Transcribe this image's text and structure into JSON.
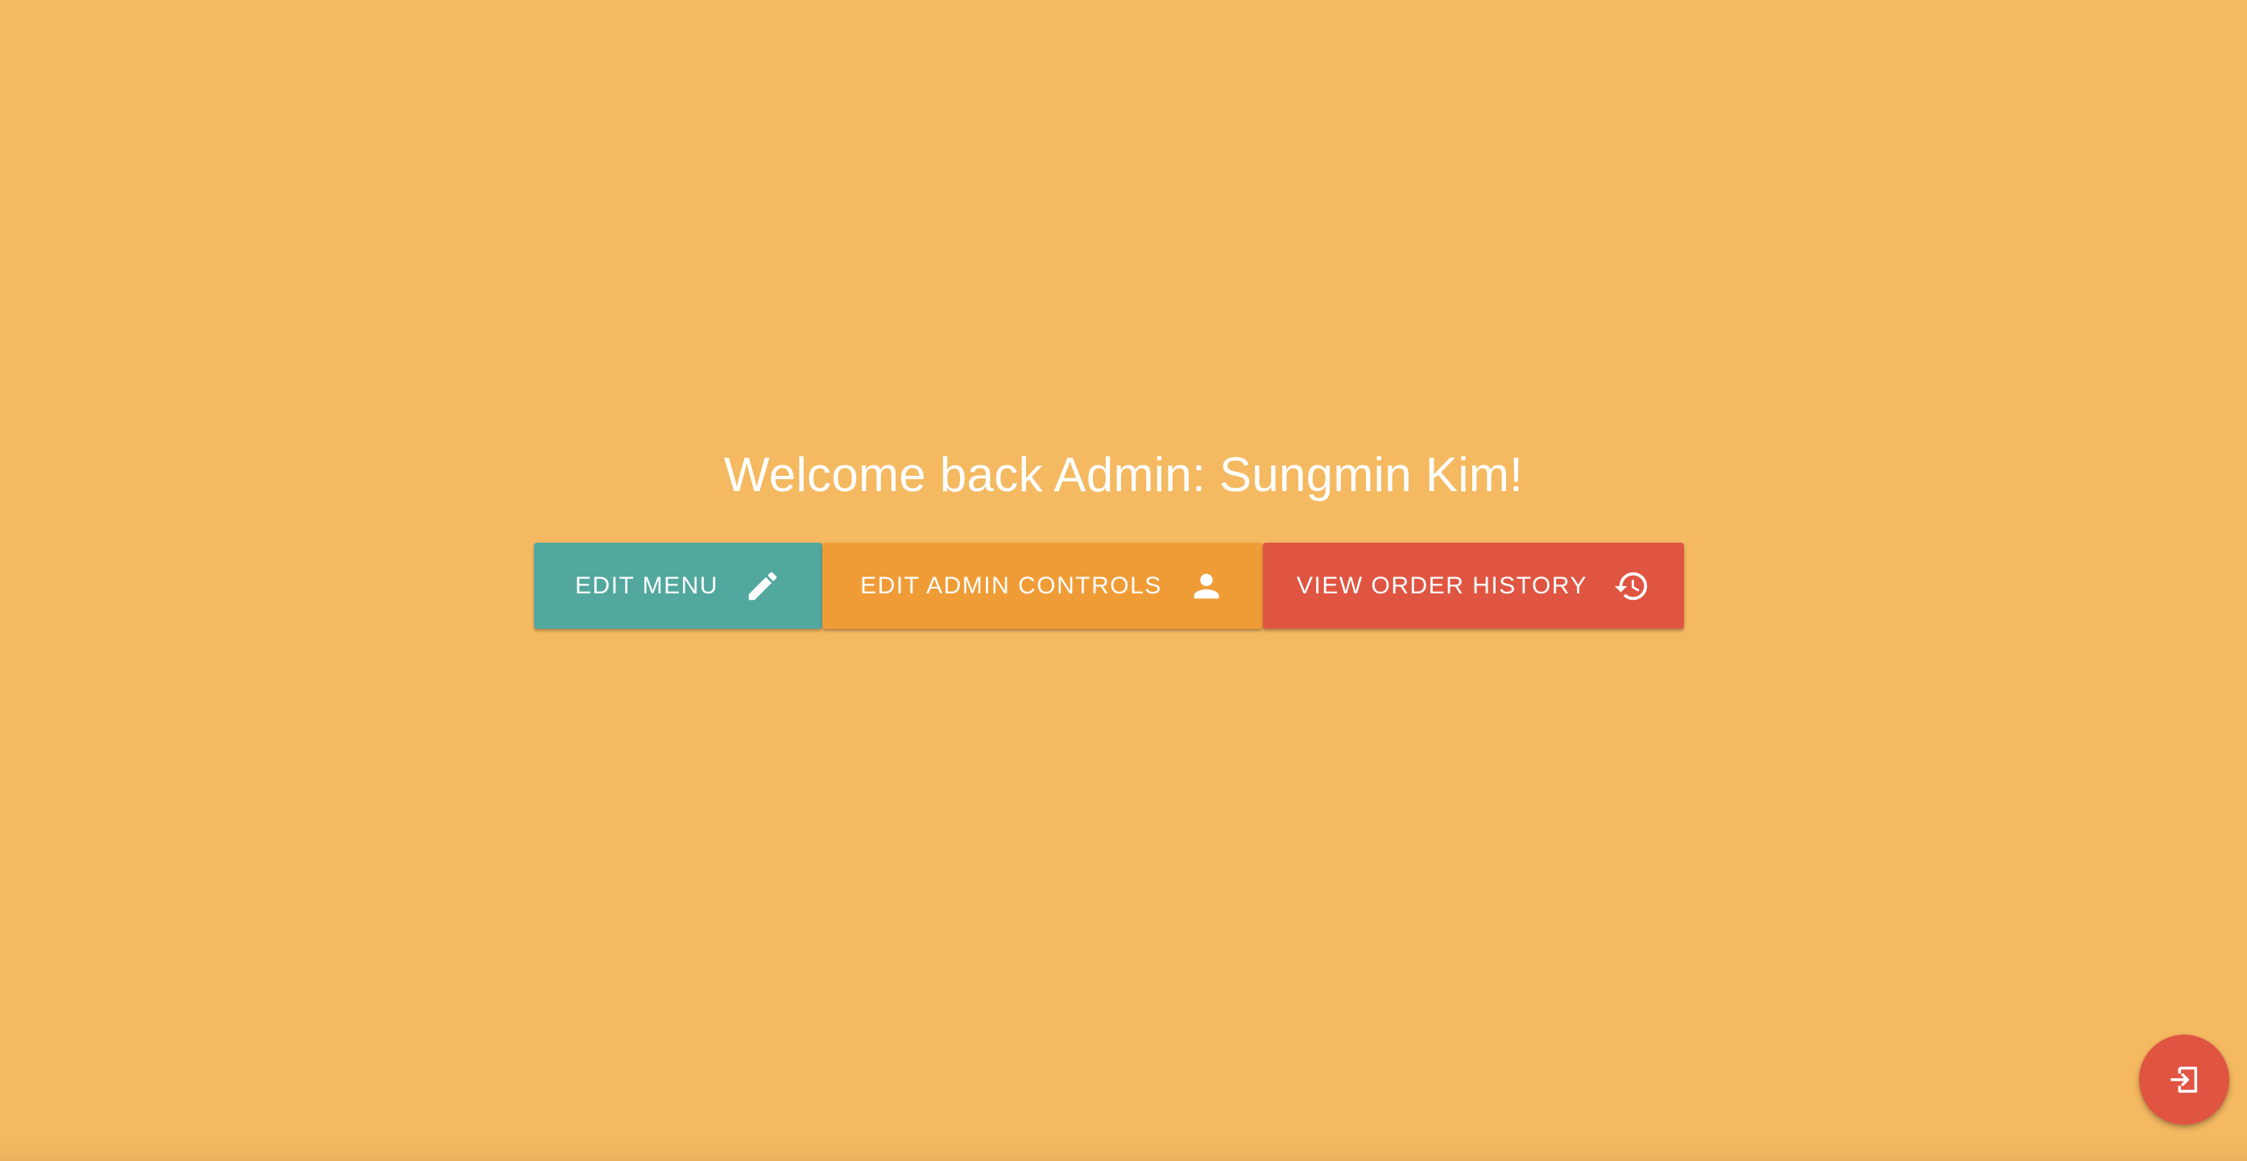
{
  "page": {
    "background_color": "#F4B961"
  },
  "header": {
    "welcome_text": "Welcome back Admin: Sungmin Kim!"
  },
  "actions": [
    {
      "label": "EDIT MENU",
      "icon": "pencil-icon",
      "color": "#52A89E"
    },
    {
      "label": "EDIT ADMIN CONTROLS",
      "icon": "person-icon",
      "color": "#F09C36"
    },
    {
      "label": "VIEW ORDER HISTORY",
      "icon": "history-icon",
      "color": "#E05542"
    }
  ],
  "logout_fab": {
    "icon": "logout-icon",
    "color": "#E05542"
  }
}
